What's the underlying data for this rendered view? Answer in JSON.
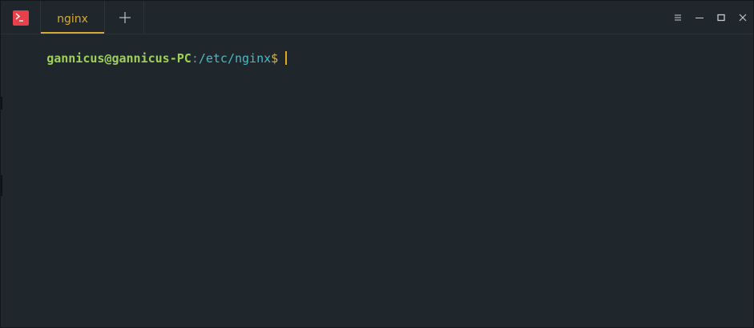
{
  "window": {
    "app_icon": "terminal-icon",
    "colors": {
      "background": "#1f262c",
      "accent": "#d6a83a",
      "app_icon_bg": "#e8404b",
      "user_host": "#9ed05a",
      "path": "#4fb8c4",
      "dollar": "#cfb35a"
    }
  },
  "tabs": [
    {
      "label": "nginx",
      "active": true
    }
  ],
  "new_tab_icon": "plus-icon",
  "controls": {
    "menu_icon": "menu-icon",
    "minimize_icon": "minimize-icon",
    "maximize_icon": "maximize-icon",
    "close_icon": "close-icon"
  },
  "terminal": {
    "user_host": "gannicus@gannicus-PC",
    "separator": ":",
    "path": "/etc/nginx",
    "prompt_symbol": "$"
  }
}
